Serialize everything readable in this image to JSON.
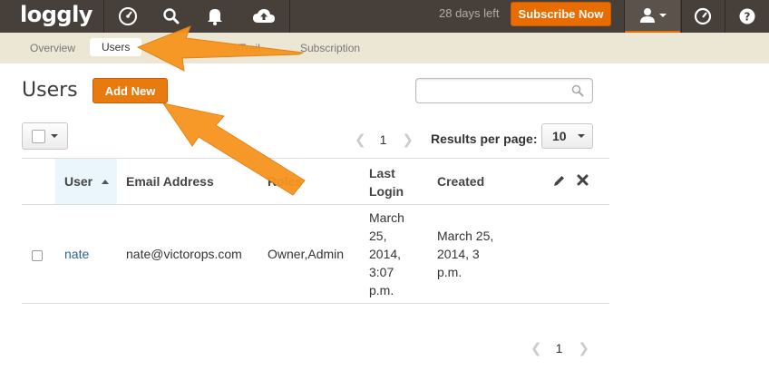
{
  "app": {
    "logo": "loggly"
  },
  "topbar": {
    "icons": [
      "dashboard-gauge-icon",
      "search-icon",
      "alert-bell-icon",
      "cloud-upload-icon"
    ],
    "trial_text": "28 days left",
    "subscribe_label": "Subscribe Now",
    "right_icons": [
      "user-icon",
      "gauge-icon",
      "help-icon"
    ],
    "accent_color": "#e86c00",
    "bar_color": "#47403a"
  },
  "subnav": {
    "items": [
      {
        "label": "Overview",
        "active": false
      },
      {
        "label": "Users",
        "active": true
      },
      {
        "label": "AuditTrail",
        "active": false
      },
      {
        "label": "Subscription",
        "active": false
      }
    ],
    "partial_visible": "l/Trail"
  },
  "page": {
    "title": "Users",
    "add_new_label": "Add New",
    "search": {
      "value": "",
      "placeholder": ""
    }
  },
  "controls": {
    "page_number": "1",
    "results_per_page_label": "Results per page:",
    "results_per_page_value": "10"
  },
  "table": {
    "columns": [
      "User",
      "Email Address",
      "Roles",
      "Last Login",
      "Created"
    ],
    "sorted_column": "User",
    "rows": [
      {
        "user": "nate",
        "email": "nate@victorops.com",
        "roles": "Owner,Admin",
        "last_login": [
          "March",
          "25,",
          "2014,",
          "3:07",
          "p.m."
        ],
        "created": [
          "March 25,",
          "2014, 3",
          "p.m."
        ]
      }
    ]
  },
  "bottom_pager": {
    "page_number": "1"
  }
}
